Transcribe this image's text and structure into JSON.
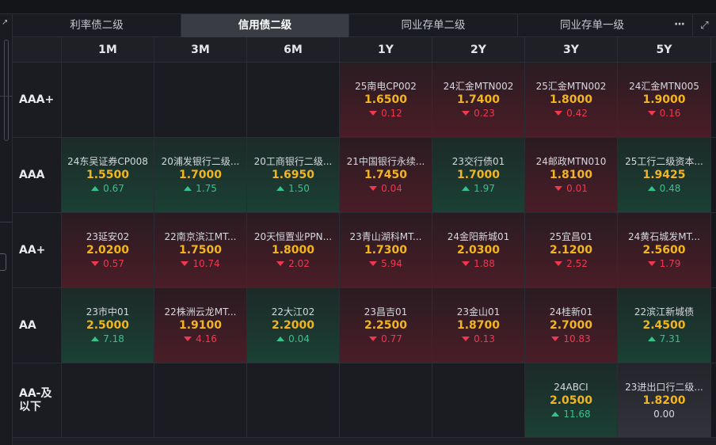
{
  "tabs": [
    {
      "label": "利率债二级",
      "active": false
    },
    {
      "label": "信用债二级",
      "active": true
    },
    {
      "label": "同业存单二级",
      "active": false
    },
    {
      "label": "同业存单一级",
      "active": false
    }
  ],
  "tab_more": "···",
  "left_corner_icon": "↗",
  "expand_icon": "⤢",
  "columns": [
    "1M",
    "3M",
    "6M",
    "1Y",
    "2Y",
    "3Y",
    "5Y"
  ],
  "rows": [
    {
      "label": "AAA+",
      "cells": [
        null,
        null,
        null,
        {
          "name": "25南电CP002",
          "rate": "1.6500",
          "change": "0.12",
          "dir": "down"
        },
        {
          "name": "24汇金MTN002",
          "rate": "1.7400",
          "change": "0.23",
          "dir": "down"
        },
        {
          "name": "25汇金MTN002",
          "rate": "1.8000",
          "change": "0.42",
          "dir": "down"
        },
        {
          "name": "24汇金MTN005",
          "rate": "1.9000",
          "change": "0.16",
          "dir": "down"
        }
      ]
    },
    {
      "label": "AAA",
      "cells": [
        {
          "name": "24东吴证券CP008",
          "rate": "1.5500",
          "change": "0.67",
          "dir": "up"
        },
        {
          "name": "20浦发银行二级...",
          "rate": "1.7000",
          "change": "1.75",
          "dir": "up"
        },
        {
          "name": "20工商银行二级...",
          "rate": "1.6950",
          "change": "1.50",
          "dir": "up"
        },
        {
          "name": "21中国银行永续...",
          "rate": "1.7450",
          "change": "0.04",
          "dir": "down"
        },
        {
          "name": "23交行债01",
          "rate": "1.7000",
          "change": "1.97",
          "dir": "up"
        },
        {
          "name": "24邮政MTN010",
          "rate": "1.8100",
          "change": "0.01",
          "dir": "down"
        },
        {
          "name": "25工行二级资本...",
          "rate": "1.9425",
          "change": "0.48",
          "dir": "up"
        }
      ]
    },
    {
      "label": "AA+",
      "cells": [
        {
          "name": "23延安02",
          "rate": "2.0200",
          "change": "0.57",
          "dir": "down"
        },
        {
          "name": "22南京滨江MT...",
          "rate": "1.7500",
          "change": "10.74",
          "dir": "down"
        },
        {
          "name": "20天恒置业PPN...",
          "rate": "1.8000",
          "change": "2.02",
          "dir": "down"
        },
        {
          "name": "23青山湖科MT...",
          "rate": "1.7300",
          "change": "5.94",
          "dir": "down"
        },
        {
          "name": "24金阳新城01",
          "rate": "2.0300",
          "change": "1.88",
          "dir": "down"
        },
        {
          "name": "25宜昌01",
          "rate": "2.1200",
          "change": "2.52",
          "dir": "down"
        },
        {
          "name": "24黄石城发MT...",
          "rate": "2.5600",
          "change": "1.79",
          "dir": "down"
        }
      ]
    },
    {
      "label": "AA",
      "cells": [
        {
          "name": "23市中01",
          "rate": "2.5000",
          "change": "7.18",
          "dir": "up"
        },
        {
          "name": "22株洲云龙MT...",
          "rate": "1.9100",
          "change": "4.16",
          "dir": "down"
        },
        {
          "name": "22大江02",
          "rate": "2.2000",
          "change": "0.04",
          "dir": "up"
        },
        {
          "name": "23昌吉01",
          "rate": "2.2500",
          "change": "0.77",
          "dir": "down"
        },
        {
          "name": "23金山01",
          "rate": "1.8700",
          "change": "0.13",
          "dir": "down"
        },
        {
          "name": "24桂新01",
          "rate": "2.7000",
          "change": "10.83",
          "dir": "down"
        },
        {
          "name": "22滨江新城债",
          "rate": "2.4500",
          "change": "7.31",
          "dir": "up"
        }
      ]
    },
    {
      "label": "AA-及以下",
      "cells": [
        null,
        null,
        null,
        null,
        null,
        {
          "name": "24ABCI",
          "rate": "2.0500",
          "change": "11.68",
          "dir": "up"
        },
        {
          "name": "23进出口行二级...",
          "rate": "1.8200",
          "change": "0.00",
          "dir": "flat"
        }
      ]
    }
  ]
}
